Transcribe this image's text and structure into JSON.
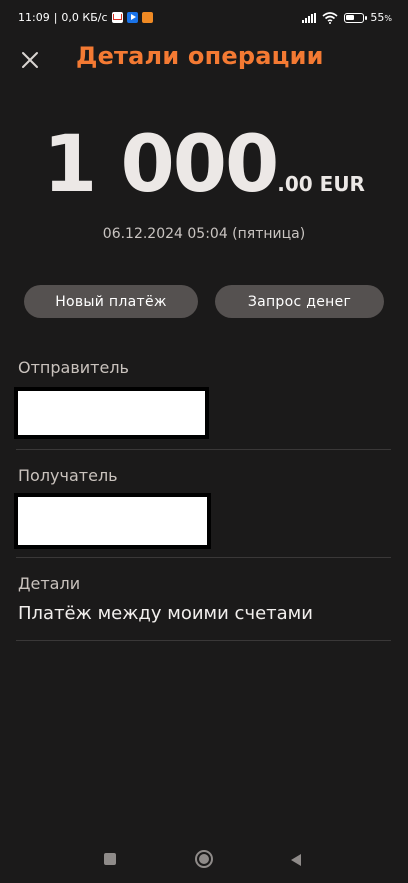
{
  "status_bar": {
    "time": "11:09",
    "speed": "0,0 КБ/с",
    "battery": "55",
    "battery_unit": "%",
    "battery_level": 0.55,
    "icons": [
      "gmail-icon",
      "play-icon",
      "app-icon",
      "signal-icon",
      "wifi-icon",
      "battery-icon"
    ]
  },
  "header": {
    "title": "Детали операции",
    "close_icon": "close-icon"
  },
  "amount": {
    "integer": "1 000",
    "decimal": ".00 EUR"
  },
  "datetime": "06.12.2024 05:04 (пятница)",
  "actions": {
    "new_payment": "Новый платёж",
    "request_money": "Запрос денег"
  },
  "details": {
    "sender_label": "Отправитель",
    "recipient_label": "Получатель",
    "details_label": "Детали",
    "details_value": "Платёж между моими счетами"
  },
  "colors": {
    "background": "#1b1a1a",
    "accent": "#f47a33",
    "pill": "#555150"
  }
}
